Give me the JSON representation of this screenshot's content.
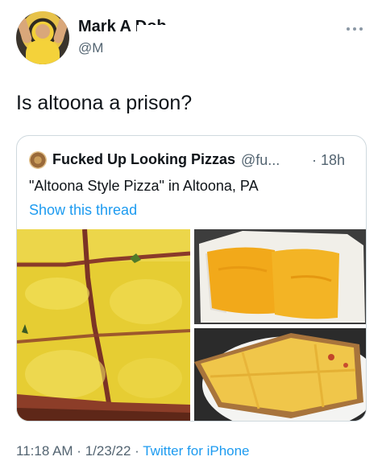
{
  "author": {
    "name": "Mark A Dob",
    "handle": "@M"
  },
  "tweet": {
    "text": "Is altoona a prison?"
  },
  "quote": {
    "name": "Fucked Up Looking Pizzas",
    "handle": "@fu...",
    "separator": "·",
    "time": "18h",
    "text": "\"Altoona Style Pizza\" in Altoona, PA",
    "show_thread": "Show this thread"
  },
  "footer": {
    "time": "11:18 AM",
    "sep1": " · ",
    "date": "1/23/22",
    "sep2": " · ",
    "source": "Twitter for iPhone"
  },
  "icons": {
    "more": "more-icon"
  },
  "colors": {
    "accent": "#1d9bf0",
    "secondary_text": "#536471",
    "border": "#cfd9de"
  }
}
